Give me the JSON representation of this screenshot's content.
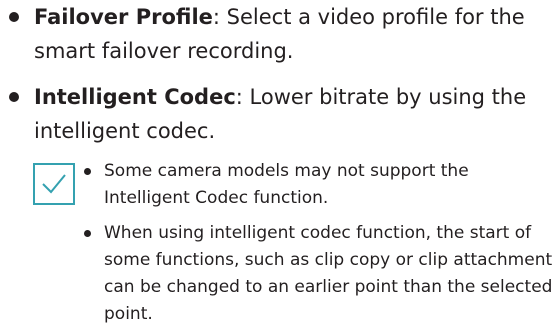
{
  "items": [
    {
      "term": "Failover Profile",
      "text": ": Select a video profile for the smart failover recording."
    },
    {
      "term": "Intelligent Codec",
      "text": ": Lower bitrate by using the intelligent codec."
    }
  ],
  "note": {
    "icon": "checkmark-icon",
    "border_color": "#34a1b0",
    "check_color": "#34a1b0",
    "items": [
      "Some camera models may not support the Intelligent Codec function.",
      "When using intelligent codec function, the start of some functions, such as clip copy or clip attachment can be changed to an earlier point than the selected point."
    ]
  }
}
